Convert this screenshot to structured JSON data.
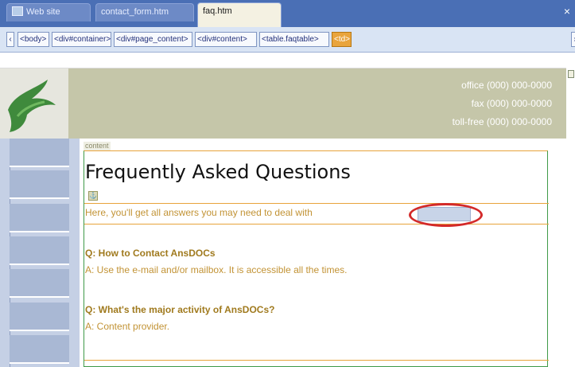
{
  "tabs": [
    {
      "label": "Web site"
    },
    {
      "label": "contact_form.htm"
    },
    {
      "label": "faq.htm",
      "active": true
    }
  ],
  "tab_close": "×",
  "tag_selector": {
    "scroll_left": "‹",
    "scroll_right": "›",
    "tags": [
      {
        "label": "<body>"
      },
      {
        "label": "<div#container>"
      },
      {
        "label": "<div#page_content>"
      },
      {
        "label": "<div#content>"
      },
      {
        "label": "<table.faqtable>"
      },
      {
        "label": "<td>",
        "selected": true
      }
    ]
  },
  "header": {
    "office": "office (000) 000-0000",
    "fax": "fax (000) 000-0000",
    "tollfree": "toll-free (000) 000-0000"
  },
  "content": {
    "region_label": "content",
    "title": "Frequently Asked Questions",
    "intro": "Here, you'll get all answers you may need to deal with",
    "faqs": [
      {
        "question": "Q: How to Contact AnsDOCs",
        "answer": "A: Use the e-mail and/or mailbox. It is accessible all the times."
      },
      {
        "question": "Q: What's the major activity of AnsDOCs?",
        "answer": "A: Content provider."
      }
    ]
  },
  "colors": {
    "tabbar": "#4a6fb5",
    "header": "#c5c6a9",
    "nav": "#c5d0e5",
    "accent_gold": "#c29335",
    "highlight": "#d32a2a",
    "selected_tag": "#e9a43c"
  }
}
